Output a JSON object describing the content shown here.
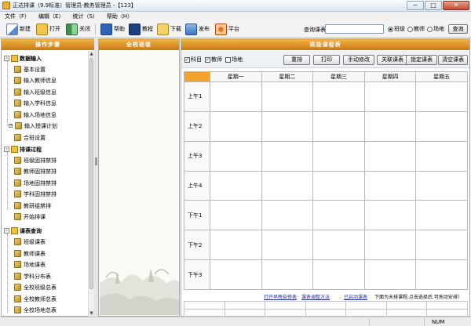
{
  "window": {
    "title": "正达排课（9.9标准）管理员-教务管理员 -【123】",
    "controls": [
      "─",
      "□",
      "✕"
    ]
  },
  "menu": [
    "文件（F）",
    "编辑（E）",
    "统计（S）",
    "帮助（H）"
  ],
  "toolbar": {
    "buttons": [
      {
        "label": "新建",
        "icon": "new-file-icon"
      },
      {
        "label": "打开",
        "icon": "open-folder-icon"
      },
      {
        "label": "关闭",
        "icon": "close-door-icon"
      },
      {
        "label": "帮助",
        "icon": "help-book-icon"
      },
      {
        "label": "教程",
        "icon": "tutorial-icon"
      },
      {
        "label": "下载",
        "icon": "download-folder-icon"
      },
      {
        "label": "发布",
        "icon": "publish-icon"
      },
      {
        "label": "平台",
        "icon": "platform-icon"
      }
    ],
    "query_label": "查询课表",
    "query_value": "",
    "radios": [
      {
        "label": "班级",
        "checked": true
      },
      {
        "label": "教师",
        "checked": false
      },
      {
        "label": "场地",
        "checked": false
      }
    ],
    "query_button": "查询"
  },
  "left_panel": {
    "title": "操作步骤",
    "groups": [
      {
        "label": "数据输入",
        "toggle": "-",
        "items": [
          "基本设置",
          "输入教师信息",
          "输入班级信息",
          "输入学科信息",
          "输入场地信息",
          "输入授课计划",
          "合班设置"
        ]
      },
      {
        "label": "排课过程",
        "toggle": "-",
        "items": [
          "班级固排禁排",
          "教师固排禁排",
          "场地固排禁排",
          "学科固排禁排",
          "教研组禁排",
          "开始排课"
        ]
      },
      {
        "label": "课表查询",
        "toggle": "-",
        "items": [
          "班级课表",
          "教师课表",
          "场地课表",
          "学科分布表",
          "全校班级总表",
          "全校教师总表",
          "全校场地总表"
        ]
      }
    ],
    "expandable_item_index": 5
  },
  "middle_panel": {
    "title": "全校班级"
  },
  "right_panel": {
    "title": "班级课程表",
    "checkboxes": [
      {
        "label": "科目",
        "checked": true
      },
      {
        "label": "教师",
        "checked": true
      },
      {
        "label": "场地",
        "checked": false
      }
    ],
    "actions": [
      "重排",
      "打印",
      "手动修改",
      "关联课表",
      "锁定课表",
      "清空课表"
    ],
    "days": [
      "星期一",
      "星期二",
      "星期三",
      "星期四",
      "星期五"
    ],
    "periods": [
      "上午1",
      "上午2",
      "上午3",
      "上午4",
      "下午1",
      "下午2",
      "下午3"
    ],
    "links": [
      "打开早晚自修表",
      "课表调整方法",
      "已启动课表"
    ],
    "hint": "下面为未排课程,点击选择后,可拖动安排）"
  },
  "statusbar": {
    "indicator": "NUM"
  },
  "colors": {
    "accent": "#f2a32b",
    "link": "#1a2e9c"
  }
}
